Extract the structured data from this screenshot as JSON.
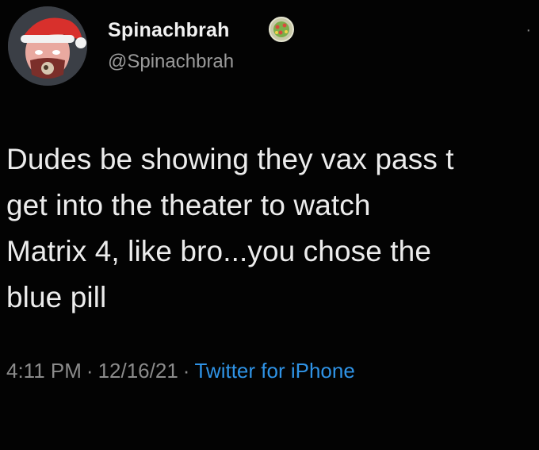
{
  "tweet": {
    "display_name": "Spinachbrah",
    "handle": "@Spinachbrah",
    "verified_icon": "emoji-badge-icon",
    "text": "Dudes be showing they vax pass t\nget into the theater to watch\nMatrix 4, like bro...you chose the\nblue pill",
    "time": "4:11 PM",
    "separator": "·",
    "date": "12/16/21",
    "source": "Twitter for iPhone"
  },
  "colors": {
    "background": "#030303",
    "text": "#ececec",
    "muted": "#8b8b8b",
    "link": "#2f93e6"
  }
}
